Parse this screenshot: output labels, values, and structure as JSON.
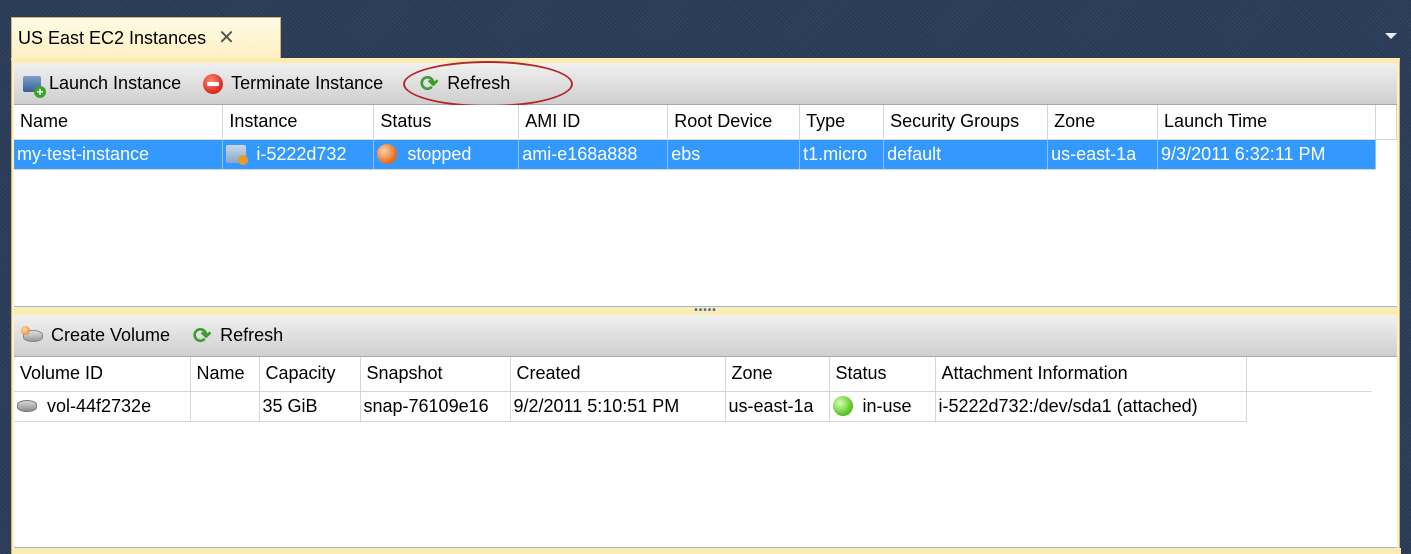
{
  "window_tab": {
    "title": "US East EC2 Instances",
    "close_glyph": "✕"
  },
  "instances_toolbar": {
    "launch_label": "Launch Instance",
    "terminate_label": "Terminate Instance",
    "refresh_label": "Refresh"
  },
  "instances_table": {
    "columns": [
      "Name",
      "Instance",
      "Status",
      "AMI ID",
      "Root Device",
      "Type",
      "Security Groups",
      "Zone",
      "Launch Time"
    ],
    "rows": [
      {
        "name": "my-test-instance",
        "instance": "i-5222d732",
        "status": "stopped",
        "ami_id": "ami-e168a888",
        "root_device": "ebs",
        "type": "t1.micro",
        "security_groups": "default",
        "zone": "us-east-1a",
        "launch_time": "9/3/2011 6:32:11 PM"
      }
    ]
  },
  "volumes_toolbar": {
    "create_label": "Create Volume",
    "refresh_label": "Refresh"
  },
  "volumes_table": {
    "columns": [
      "Volume ID",
      "Name",
      "Capacity",
      "Snapshot",
      "Created",
      "Zone",
      "Status",
      "Attachment Information"
    ],
    "rows": [
      {
        "volume_id": "vol-44f2732e",
        "name": "",
        "capacity": "35 GiB",
        "snapshot": "snap-76109e16",
        "created": "9/2/2011 5:10:51 PM",
        "zone": "us-east-1a",
        "status": "in-use",
        "attachment": "i-5222d732:/dev/sda1 (attached)"
      }
    ]
  },
  "colors": {
    "selection": "#3399ff",
    "highlight_circle": "#b1282a",
    "status_stopped": "#e36a16",
    "status_in_use": "#53c21a"
  }
}
